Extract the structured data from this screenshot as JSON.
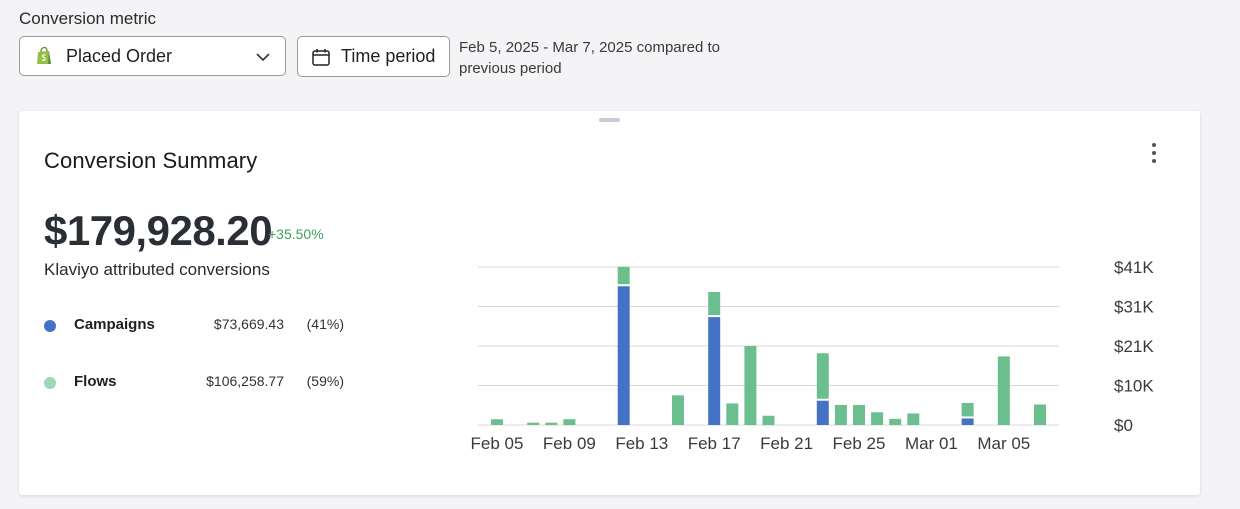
{
  "filters": {
    "metric_label": "Conversion metric",
    "metric_value": "Placed Order",
    "time_button_label": "Time period",
    "date_range_text": "Feb 5, 2025 - Mar 7, 2025 compared to previous period"
  },
  "card": {
    "title": "Conversion Summary",
    "total": "$179,928.20",
    "delta": "+35.50%",
    "subtitle": "Klaviyo attributed conversions",
    "legend": [
      {
        "name": "Campaigns",
        "value": "$73,669.43",
        "pct": "(41%)",
        "color": "#4472c4"
      },
      {
        "name": "Flows",
        "value": "$106,258.77",
        "pct": "(59%)",
        "color": "#6bbf8e"
      }
    ]
  },
  "colors": {
    "campaigns": "#4472c4",
    "flows": "#6bbf8e",
    "delta_positive": "#3aa35a",
    "grid": "#d8d8d8"
  },
  "icons": {
    "metric_icon": "shopify-bag-icon",
    "dropdown_icon": "chevron-down-icon",
    "time_icon": "calendar-icon",
    "menu_icon": "kebab-menu-icon"
  },
  "chart_data": {
    "type": "bar",
    "stacked": true,
    "x_tick_labels": [
      "Feb 05",
      "Feb 09",
      "Feb 13",
      "Feb 17",
      "Feb 21",
      "Feb 25",
      "Mar 01",
      "Mar 05"
    ],
    "y_tick_labels": [
      "$41K",
      "$31K",
      "$21K",
      "$10K",
      "$0"
    ],
    "ylim": [
      0,
      41000
    ],
    "categories": [
      "Feb 05",
      "Feb 06",
      "Feb 07",
      "Feb 08",
      "Feb 09",
      "Feb 10",
      "Feb 11",
      "Feb 12",
      "Feb 13",
      "Feb 14",
      "Feb 15",
      "Feb 16",
      "Feb 17",
      "Feb 18",
      "Feb 19",
      "Feb 20",
      "Feb 21",
      "Feb 22",
      "Feb 23",
      "Feb 24",
      "Feb 25",
      "Feb 26",
      "Feb 27",
      "Feb 28",
      "Mar 01",
      "Mar 02",
      "Mar 03",
      "Mar 04",
      "Mar 05",
      "Mar 06",
      "Mar 07"
    ],
    "series": [
      {
        "name": "Campaigns",
        "values": [
          0,
          0,
          0,
          0,
          0,
          0,
          0,
          36000,
          0,
          0,
          0,
          0,
          28000,
          0,
          0,
          0,
          0,
          0,
          6300,
          0,
          0,
          0,
          0,
          0,
          0,
          0,
          1700,
          0,
          0,
          0,
          0
        ]
      },
      {
        "name": "Flows",
        "values": [
          1500,
          0,
          600,
          600,
          1500,
          0,
          0,
          4500,
          0,
          0,
          7700,
          0,
          6000,
          5600,
          20500,
          2400,
          0,
          0,
          11800,
          5200,
          5200,
          3300,
          1600,
          3000,
          0,
          0,
          3500,
          0,
          17800,
          0,
          5300
        ]
      }
    ],
    "grid": true,
    "legend": "left-side list"
  }
}
